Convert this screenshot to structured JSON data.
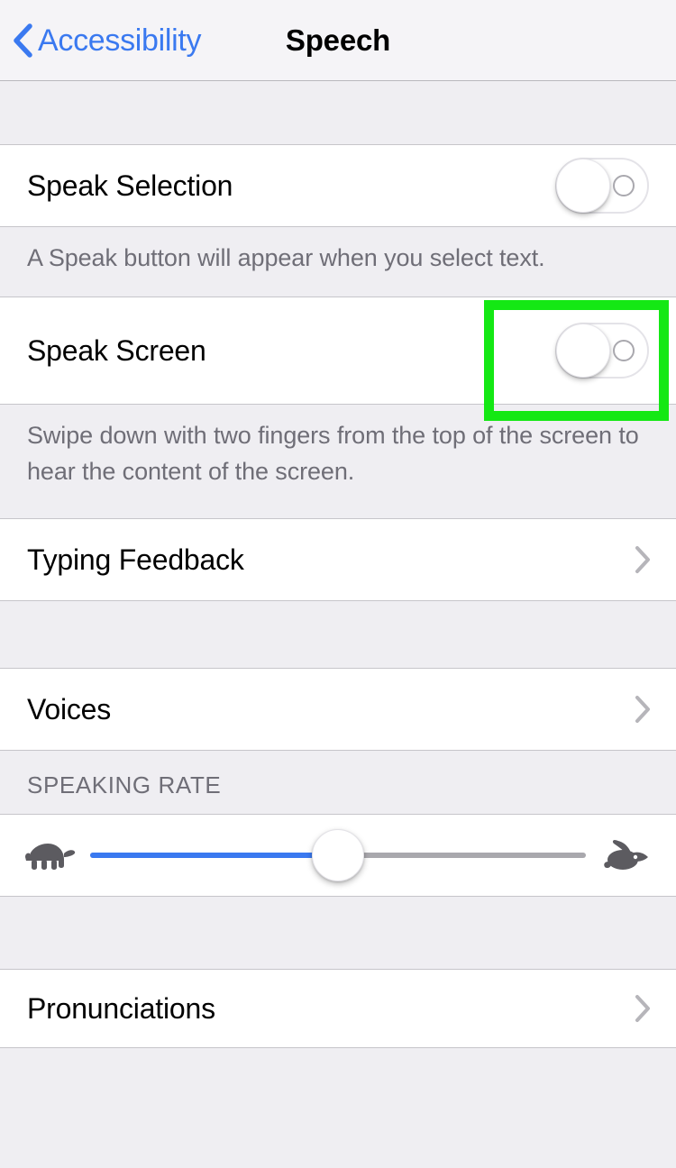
{
  "navbar": {
    "back_label": "Accessibility",
    "back_icon": "chevron-left-icon",
    "title": "Speech"
  },
  "sections": [
    {
      "rows": [
        {
          "label": "Speak Selection",
          "control": "toggle",
          "value": "off"
        }
      ],
      "footer": "A Speak button will appear when you select text."
    },
    {
      "rows": [
        {
          "label": "Speak Screen",
          "control": "toggle",
          "value": "off",
          "highlighted": true
        }
      ],
      "footer": "Swipe down with two fingers from the top of the screen to hear the content of the screen."
    },
    {
      "rows": [
        {
          "label": "Typing Feedback",
          "control": "disclosure"
        }
      ]
    },
    {
      "rows": [
        {
          "label": "Voices",
          "control": "disclosure"
        }
      ]
    },
    {
      "header": "SPEAKING RATE",
      "rows": [
        {
          "control": "slider",
          "left_icon": "turtle-icon",
          "right_icon": "rabbit-icon",
          "value_percent": 50
        }
      ]
    },
    {
      "rows": [
        {
          "label": "Pronunciations",
          "control": "disclosure"
        }
      ]
    }
  ],
  "colors": {
    "accent_blue": "#3a79f0",
    "page_background": "#efeef2",
    "row_background": "#ffffff",
    "separator": "#c6c5ca",
    "secondary_text": "#6f6e77",
    "highlight_green": "#14e814",
    "icon_gray": "#5c5b60"
  }
}
